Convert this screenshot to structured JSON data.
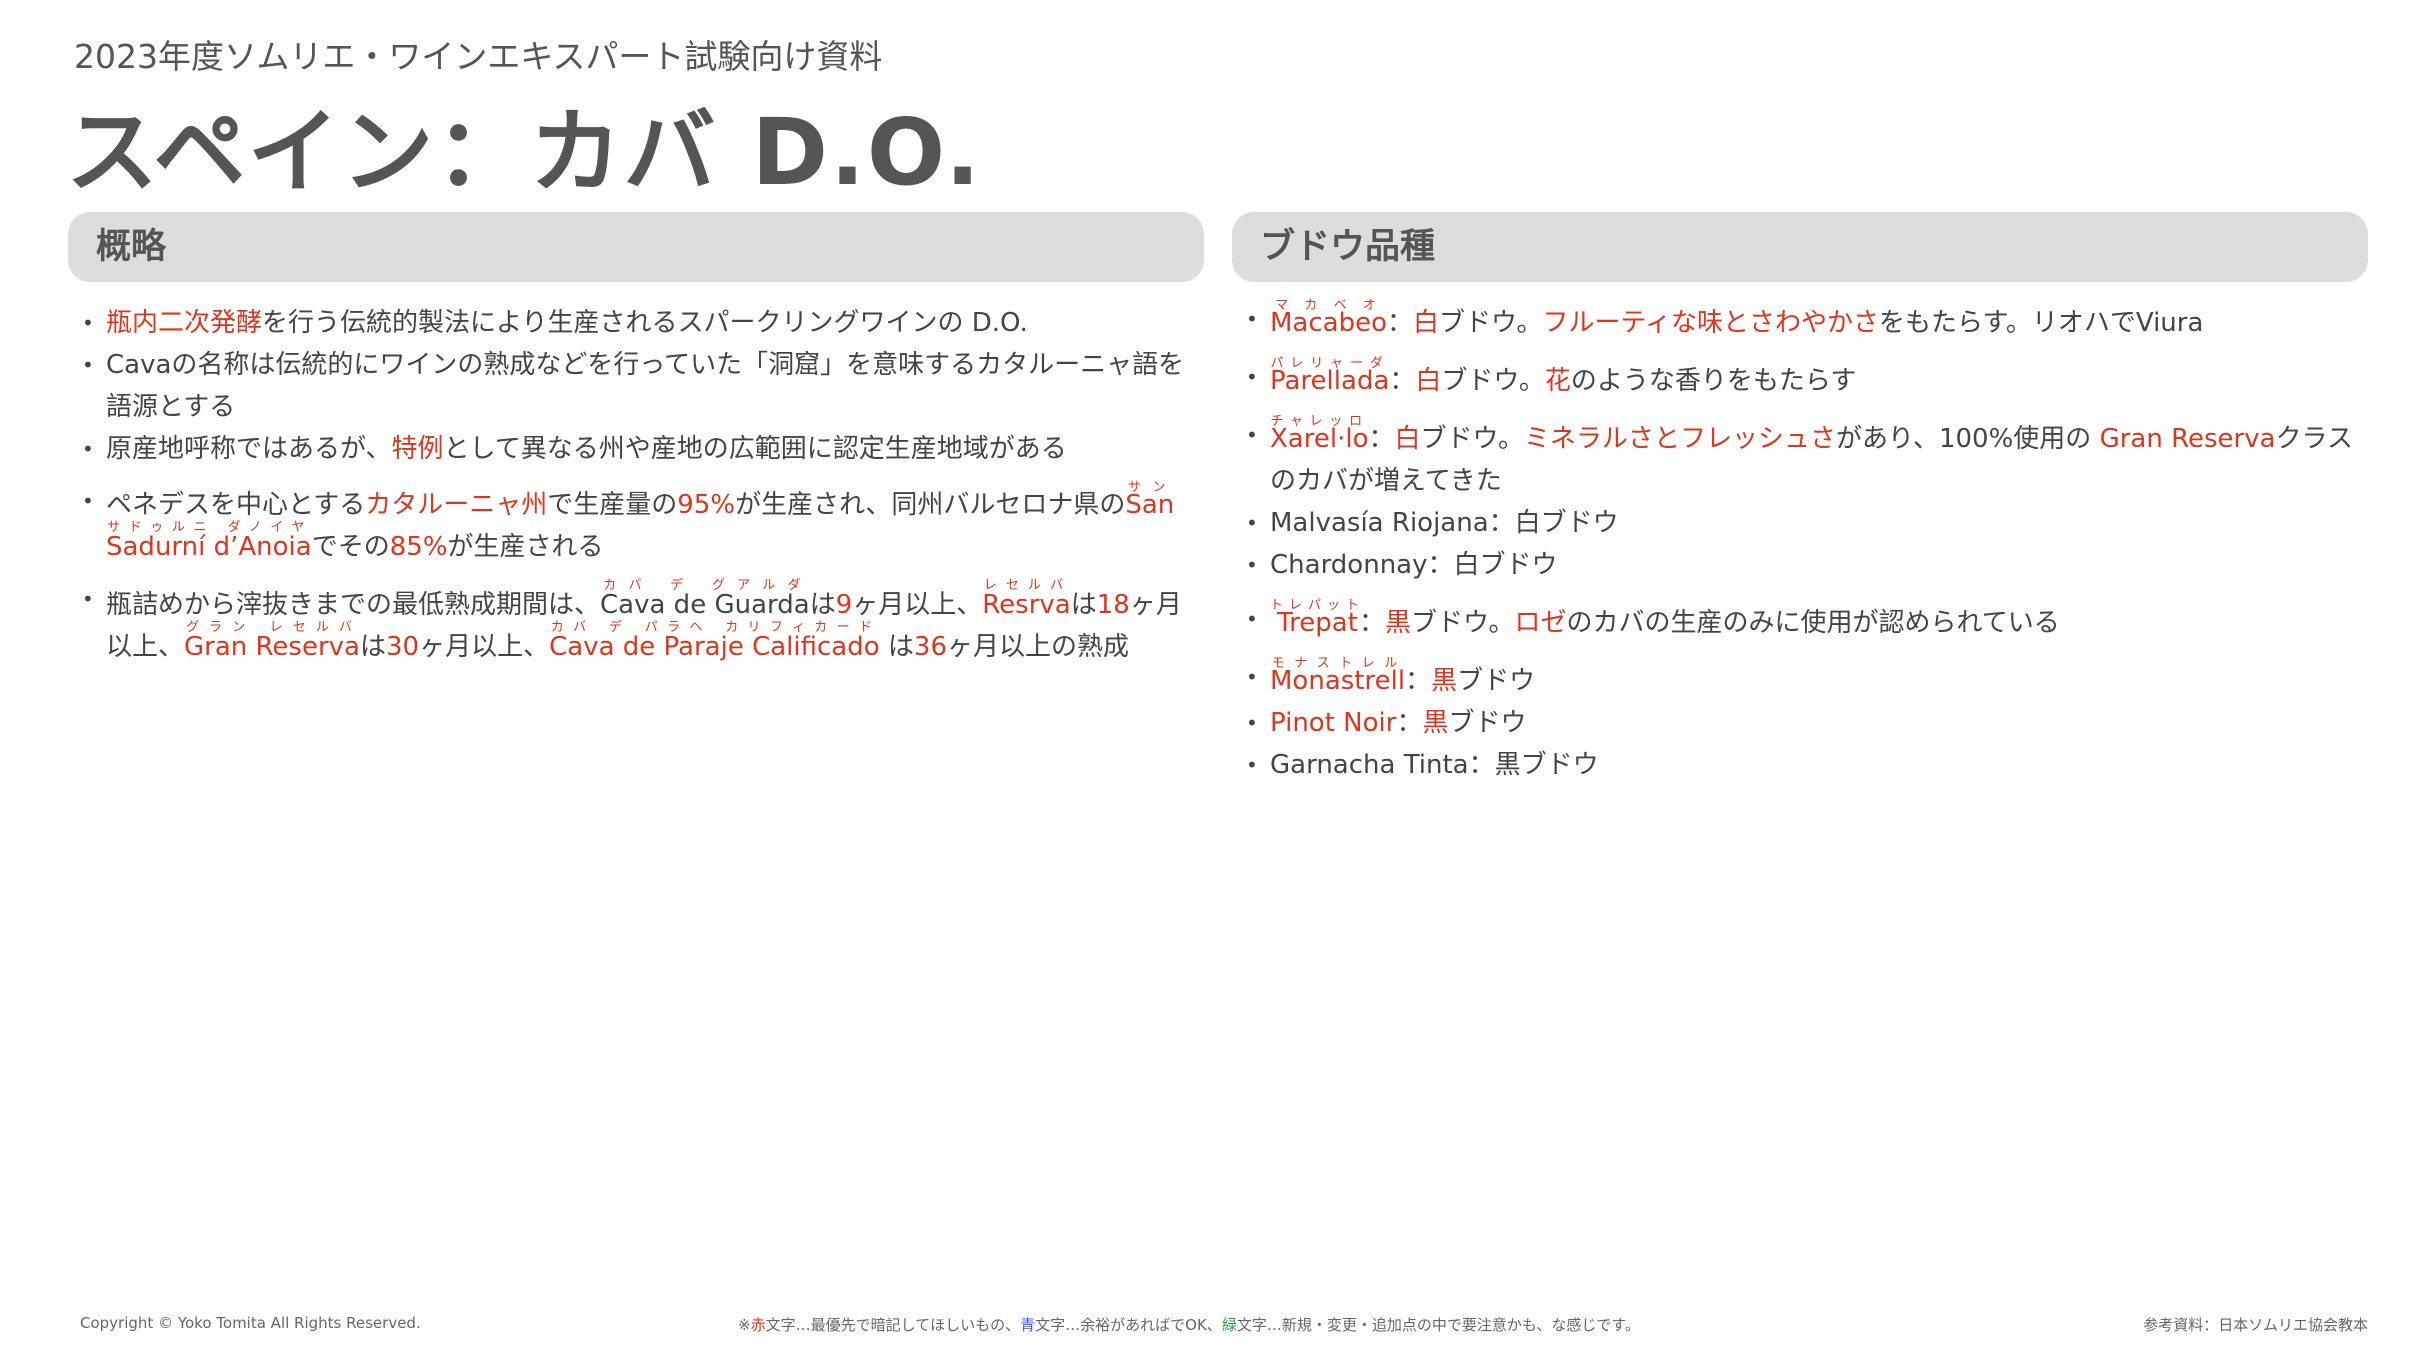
{
  "header": {
    "subtitle": "2023年度ソムリエ・ワインエキスパート試験向け資料",
    "title": "スペイン：カバ D.O."
  },
  "overview": {
    "heading": "概略",
    "items": [
      {
        "parts": [
          {
            "t": "瓶内二次発酵",
            "c": "red"
          },
          {
            "t": "を行う伝統的製法により生産されるスパークリングワインの D.O."
          }
        ]
      },
      {
        "parts": [
          {
            "t": "Cavaの名称は伝統的にワインの熟成などを行っていた「洞窟」を意味するカタルーニャ語を語源とする"
          }
        ]
      },
      {
        "parts": [
          {
            "t": "原産地呼称ではあるが、"
          },
          {
            "t": "特例",
            "c": "red"
          },
          {
            "t": "として異なる州や産地の広範囲に認定生産地域がある"
          }
        ]
      },
      {
        "gap": true,
        "parts": [
          {
            "t": "ペネデスを中心とする"
          },
          {
            "t": "カタルーニャ州",
            "c": "red"
          },
          {
            "t": "で生産量の"
          },
          {
            "t": "95%",
            "c": "red"
          },
          {
            "t": "が生産され、同州バルセロナ県の"
          },
          {
            "t": "San",
            "c": "red",
            "rt": "サン"
          },
          {
            "t": " "
          },
          {
            "t": "Sadurní d’Anoia",
            "c": "red",
            "rt": "サドゥルニ ダノイヤ"
          },
          {
            "t": "でその"
          },
          {
            "t": "85%",
            "c": "red"
          },
          {
            "t": "が生産される"
          }
        ]
      },
      {
        "gap": true,
        "parts": [
          {
            "t": "瓶詰めから滓抜きまでの最低熟成期間は、"
          },
          {
            "t": "Cava de Guarda",
            "rt": "カバ デ グアルダ"
          },
          {
            "t": "は"
          },
          {
            "t": "9",
            "c": "red"
          },
          {
            "t": "ヶ月以上、"
          },
          {
            "t": "Resrva",
            "c": "red",
            "rt": "レセルバ"
          },
          {
            "t": "は"
          },
          {
            "t": "18",
            "c": "red"
          },
          {
            "t": "ヶ月以上、"
          },
          {
            "t": "Gran Reserva",
            "c": "red",
            "rt": "グラン レセルバ"
          },
          {
            "t": "は"
          },
          {
            "t": "30",
            "c": "red"
          },
          {
            "t": "ヶ月以上、"
          },
          {
            "t": "Cava de Paraje Calificado",
            "c": "red",
            "rt": "カバ デ パラヘ カリフィカード"
          },
          {
            "t": " は"
          },
          {
            "t": "36",
            "c": "red"
          },
          {
            "t": "ヶ月以上の熟成"
          }
        ]
      }
    ]
  },
  "grapes": {
    "heading": "ブドウ品種",
    "items": [
      {
        "ruby": true,
        "parts": [
          {
            "t": "Macabeo",
            "c": "red",
            "rt": "マカベオ"
          },
          {
            "t": "："
          },
          {
            "t": "白",
            "c": "red"
          },
          {
            "t": "ブドウ。"
          },
          {
            "t": "フルーティな味とさわやかさ",
            "c": "red"
          },
          {
            "t": "をもたらす。リオハでViura"
          }
        ]
      },
      {
        "ruby": true,
        "parts": [
          {
            "t": "Parellada",
            "c": "red",
            "rt": "パレリャーダ"
          },
          {
            "t": "："
          },
          {
            "t": "白",
            "c": "red"
          },
          {
            "t": "ブドウ。"
          },
          {
            "t": "花",
            "c": "red"
          },
          {
            "t": "のような香りをもたらす"
          }
        ]
      },
      {
        "ruby": true,
        "parts": [
          {
            "t": "Xarel·lo",
            "c": "red",
            "rt": "チャレッロ"
          },
          {
            "t": "："
          },
          {
            "t": "白",
            "c": "red"
          },
          {
            "t": "ブドウ。"
          },
          {
            "t": "ミネラルさとフレッシュさ",
            "c": "red"
          },
          {
            "t": "があり、100%使用の "
          },
          {
            "t": "Gran Reserva",
            "c": "red"
          },
          {
            "t": "クラスのカバが増えてきた"
          }
        ]
      },
      {
        "parts": [
          {
            "t": "Malvasía Riojana：白ブドウ"
          }
        ]
      },
      {
        "parts": [
          {
            "t": "Chardonnay：白ブドウ"
          }
        ]
      },
      {
        "ruby": true,
        "parts": [
          {
            "t": "Trepat",
            "c": "red",
            "rt": "トレパット"
          },
          {
            "t": "："
          },
          {
            "t": "黒",
            "c": "red"
          },
          {
            "t": "ブドウ。"
          },
          {
            "t": "ロゼ",
            "c": "red"
          },
          {
            "t": "のカバの生産のみに使用が認められている"
          }
        ]
      },
      {
        "ruby": true,
        "parts": [
          {
            "t": "Monastrell",
            "c": "red",
            "rt": "モナストレル"
          },
          {
            "t": "："
          },
          {
            "t": "黒",
            "c": "red"
          },
          {
            "t": "ブドウ"
          }
        ]
      },
      {
        "parts": [
          {
            "t": "Pinot Noir",
            "c": "red"
          },
          {
            "t": "："
          },
          {
            "t": "黒",
            "c": "red"
          },
          {
            "t": "ブドウ"
          }
        ]
      },
      {
        "parts": [
          {
            "t": "Garnacha Tinta：黒ブドウ"
          }
        ]
      }
    ]
  },
  "footer": {
    "copyright": "Copyright © Yoko Tomita All Rights Reserved.",
    "legend": [
      {
        "t": "※"
      },
      {
        "t": "赤",
        "c": "red"
      },
      {
        "t": "文字…最優先で暗記してほしいもの、"
      },
      {
        "t": "青",
        "c": "blue"
      },
      {
        "t": "文字…余裕があればでOK、"
      },
      {
        "t": "緑",
        "c": "green"
      },
      {
        "t": "文字…新規・変更・追加点の中で要注意かも、な感じです。"
      }
    ],
    "reference": "参考資料：日本ソムリエ協会教本"
  },
  "colors": {
    "red": "#e0341c",
    "blue": "#3b5bdb",
    "green": "#2f9e44",
    "header_bg": "#dddddd",
    "title_text": "#555555"
  }
}
